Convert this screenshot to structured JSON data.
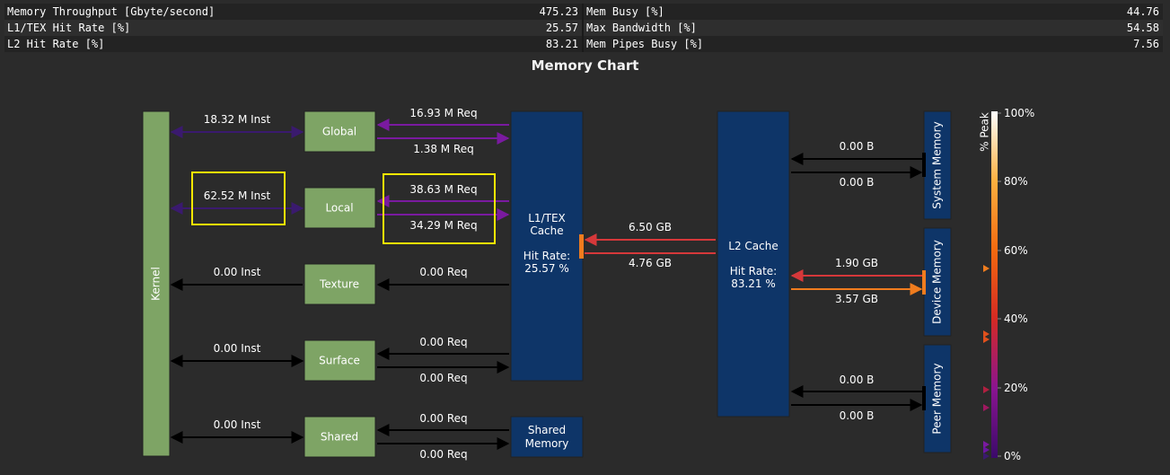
{
  "metrics": [
    {
      "left_label": "Memory Throughput [Gbyte/second]",
      "left_value": "475.23",
      "right_label": "Mem Busy [%]",
      "right_value": "44.76"
    },
    {
      "left_label": "L1/TEX Hit Rate [%]",
      "left_value": "25.57",
      "right_label": "Max Bandwidth [%]",
      "right_value": "54.58"
    },
    {
      "left_label": "L2 Hit Rate [%]",
      "left_value": "83.21",
      "right_label": "Mem Pipes Busy [%]",
      "right_value": "7.56"
    }
  ],
  "chart_title": "Memory Chart",
  "units": {
    "kernel": "Kernel",
    "global": "Global",
    "local": "Local",
    "texture": "Texture",
    "surface": "Surface",
    "shared": "Shared",
    "l1_line1": "L1/TEX",
    "l1_line2": "Cache",
    "l1_hit_label": "Hit Rate:",
    "l1_hit_value": "25.57 %",
    "shared_mem_line1": "Shared",
    "shared_mem_line2": "Memory",
    "l2_title": "L2 Cache",
    "l2_hit_label": "Hit Rate:",
    "l2_hit_value": "83.21 %",
    "system_memory": "System Memory",
    "device_memory": "Device Memory",
    "peer_memory": "Peer Memory"
  },
  "links": {
    "kernel_global": "18.32 M Inst",
    "kernel_local": "62.52 M Inst",
    "kernel_texture": "0.00 Inst",
    "kernel_surface": "0.00 Inst",
    "kernel_shared": "0.00 Inst",
    "global_req_in": "16.93 M Req",
    "global_req_out": "1.38 M Req",
    "local_req_in": "38.63 M Req",
    "local_req_out": "34.29 M Req",
    "texture_req": "0.00 Req",
    "surface_req_in": "0.00 Req",
    "surface_req_out": "0.00 Req",
    "shared_req_in": "0.00 Req",
    "shared_req_out": "0.00 Req",
    "l1_l2_in": "6.50 GB",
    "l1_l2_out": "4.76 GB",
    "sys_in": "0.00 B",
    "sys_out": "0.00 B",
    "dev_in": "1.90 GB",
    "dev_out": "3.57 GB",
    "peer_in": "0.00 B",
    "peer_out": "0.00 B"
  },
  "legend": {
    "title": "% Peak",
    "ticks": [
      "100%",
      "80%",
      "60%",
      "40%",
      "20%",
      "0%"
    ]
  },
  "colors": {
    "unit_green": "#7ea465",
    "cache_blue": "#0e3568",
    "highlight": "#ffe800",
    "purple_dark": "#3a1a6e",
    "purple": "#7a1aa0",
    "red": "#d6383a",
    "orange": "#f07c1e",
    "black": "#000000"
  }
}
